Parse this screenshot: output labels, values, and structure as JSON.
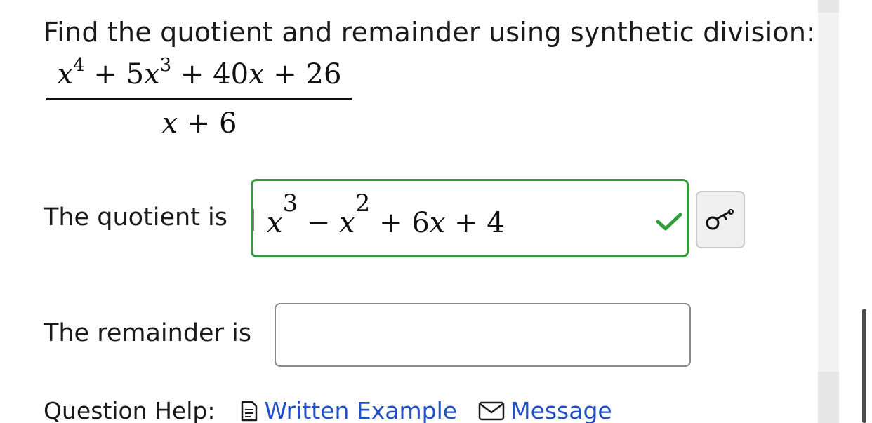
{
  "question": {
    "prompt": "Find the quotient and remainder using synthetic division:",
    "numerator": {
      "t1_base": "x",
      "t1_exp": "4",
      "op1": " + ",
      "t2_coef": "5",
      "t2_base": "x",
      "t2_exp": "3",
      "op2": " + ",
      "t3_coef": "40",
      "t3_base": "x",
      "op3": " + ",
      "t4": "26"
    },
    "denominator": {
      "t1_base": "x",
      "op": " + ",
      "t2": "6"
    }
  },
  "quotient": {
    "label": "The quotient is",
    "answer": {
      "t1_base": "x",
      "t1_exp": "3",
      "op1": " − ",
      "t2_base": "x",
      "t2_exp": "2",
      "op2": " + ",
      "t3_coef": "6",
      "t3_base": "x",
      "op3": " + ",
      "t4": "4"
    },
    "status": "correct",
    "status_color": "#2e9e3a"
  },
  "remainder": {
    "label": "The remainder is",
    "value": ""
  },
  "help": {
    "label": "Question Help:",
    "links": [
      {
        "label": "Written Example",
        "icon": "document-icon"
      },
      {
        "label": "Message",
        "icon": "mail-icon"
      }
    ]
  },
  "colors": {
    "link": "#1f4fc9",
    "correct_border": "#2e9e3a"
  }
}
